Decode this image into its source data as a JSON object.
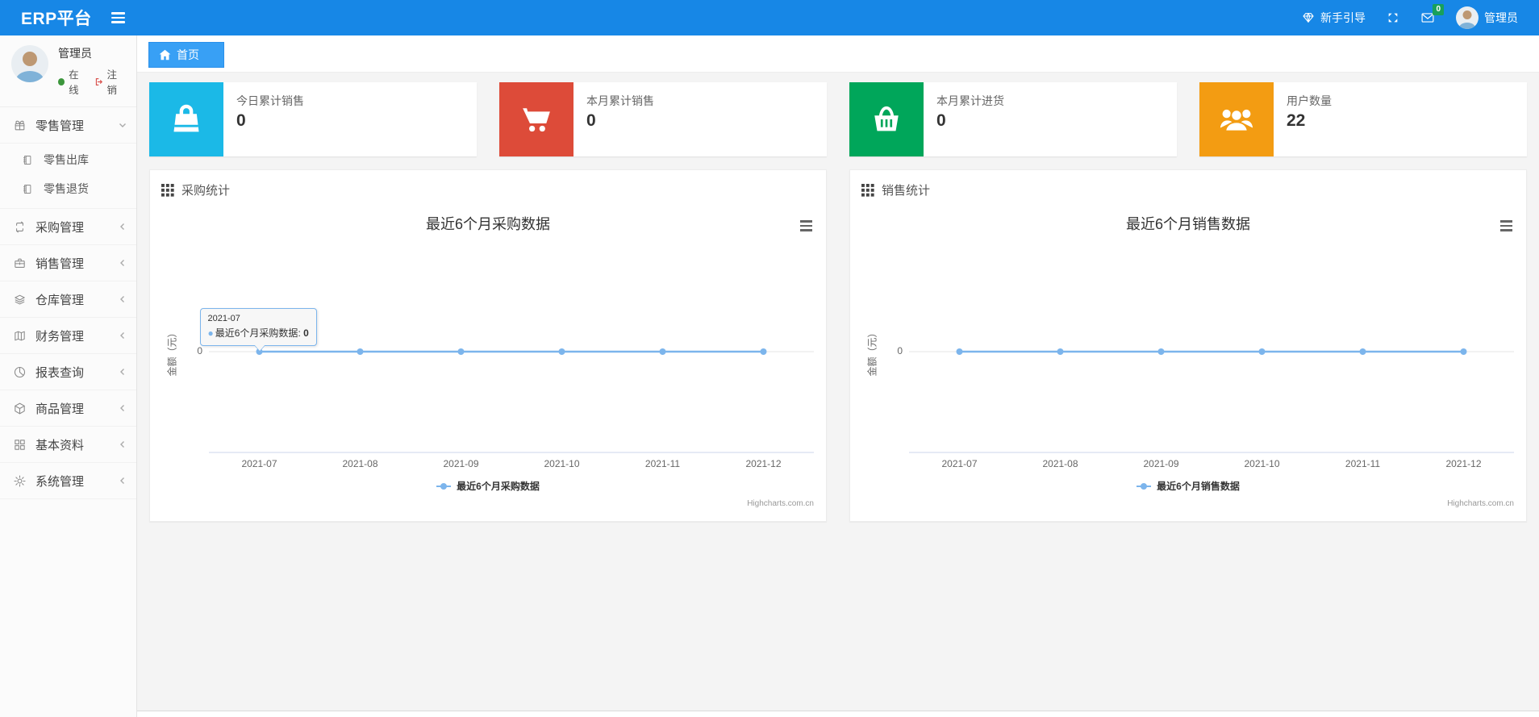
{
  "navbar": {
    "brand": "ERP平台",
    "guide_label": "新手引导",
    "message_badge": "0",
    "user_name": "管理员"
  },
  "sidebar": {
    "user": {
      "name": "管理员",
      "status_label": "在线",
      "logout_label": "注销"
    },
    "menu": [
      {
        "label": "零售管理",
        "icon": "gift-icon",
        "expanded": true,
        "children": [
          {
            "label": "零售出库",
            "icon": "journal-icon"
          },
          {
            "label": "零售退货",
            "icon": "journal-icon"
          }
        ]
      },
      {
        "label": "采购管理",
        "icon": "repeat-icon"
      },
      {
        "label": "销售管理",
        "icon": "briefcase-icon"
      },
      {
        "label": "仓库管理",
        "icon": "layers-icon"
      },
      {
        "label": "财务管理",
        "icon": "ledger-icon"
      },
      {
        "label": "报表查询",
        "icon": "pie-chart-icon"
      },
      {
        "label": "商品管理",
        "icon": "package-icon"
      },
      {
        "label": "基本资料",
        "icon": "grid-icon"
      },
      {
        "label": "系统管理",
        "icon": "gear-icon"
      }
    ]
  },
  "breadcrumb": {
    "home_label": "首页"
  },
  "stat_cards": [
    {
      "label": "今日累计销售",
      "value": "0",
      "color": "#1bb9e7",
      "icon": "shopping-bag-icon"
    },
    {
      "label": "本月累计销售",
      "value": "0",
      "color": "#dd4b39",
      "icon": "cart-icon"
    },
    {
      "label": "本月累计进货",
      "value": "0",
      "color": "#00a65a",
      "icon": "basket-icon"
    },
    {
      "label": "用户数量",
      "value": "22",
      "color": "#f39c12",
      "icon": "users-icon"
    }
  ],
  "panels": [
    {
      "title": "采购统计"
    },
    {
      "title": "销售统计"
    }
  ],
  "chart_data": [
    {
      "type": "line",
      "title": "最近6个月采购数据",
      "categories": [
        "2021-07",
        "2021-08",
        "2021-09",
        "2021-10",
        "2021-11",
        "2021-12"
      ],
      "series": [
        {
          "name": "最近6个月采购数据",
          "values": [
            0,
            0,
            0,
            0,
            0,
            0
          ]
        }
      ],
      "ylabel": "金额（元）",
      "yticks": [
        "0"
      ],
      "line_color": "#7cb5ec",
      "grid": true,
      "legend_position": "bottom",
      "credit": "Highcharts.com.cn",
      "tooltip": {
        "header": "2021-07",
        "series_name": "最近6个月采购数据",
        "value": "0"
      }
    },
    {
      "type": "line",
      "title": "最近6个月销售数据",
      "categories": [
        "2021-07",
        "2021-08",
        "2021-09",
        "2021-10",
        "2021-11",
        "2021-12"
      ],
      "series": [
        {
          "name": "最近6个月销售数据",
          "values": [
            0,
            0,
            0,
            0,
            0,
            0
          ]
        }
      ],
      "ylabel": "金额（元）",
      "yticks": [
        "0"
      ],
      "line_color": "#7cb5ec",
      "grid": true,
      "legend_position": "bottom",
      "credit": "Highcharts.com.cn"
    }
  ]
}
